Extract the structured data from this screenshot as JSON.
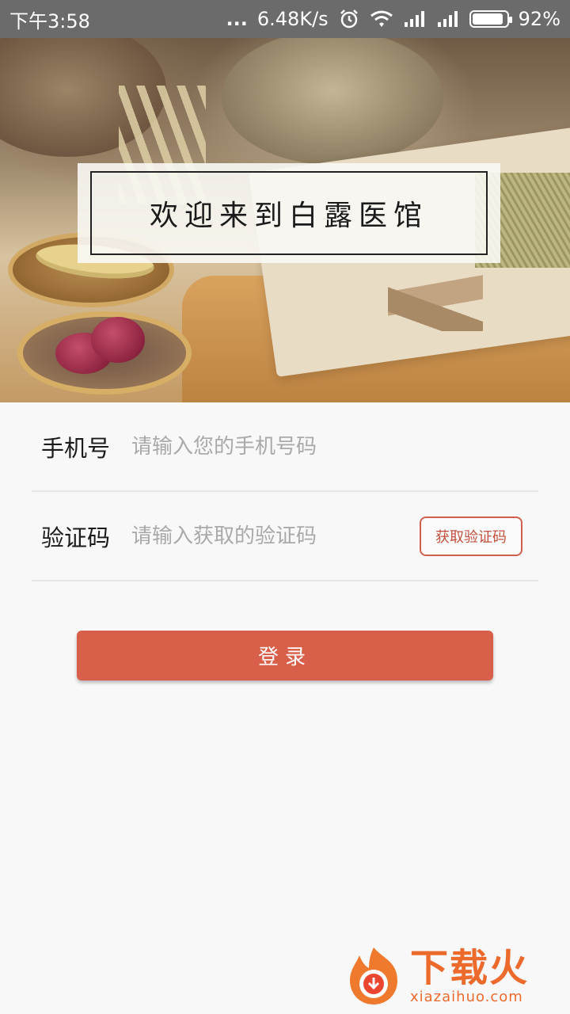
{
  "status_bar": {
    "time": "下午3:58",
    "dots": "...",
    "speed": "6.48K/s",
    "battery_percent": "92%",
    "battery_level": 0.92,
    "icons": [
      "alarm-icon",
      "wifi-icon",
      "signal-icon",
      "signal-icon",
      "battery-icon"
    ]
  },
  "banner": {
    "title": "欢迎来到白露医馆"
  },
  "form": {
    "phone": {
      "label": "手机号",
      "placeholder": "请输入您的手机号码",
      "value": ""
    },
    "code": {
      "label": "验证码",
      "placeholder": "请输入获取的验证码",
      "value": "",
      "button": "获取验证码"
    }
  },
  "login_button": "登录",
  "watermark": {
    "name": "下载火",
    "url": "xiazaihuo.com"
  },
  "colors": {
    "accent": "#d8604a",
    "status_bar": "#6b6b6b",
    "background": "#f8f8f8"
  }
}
